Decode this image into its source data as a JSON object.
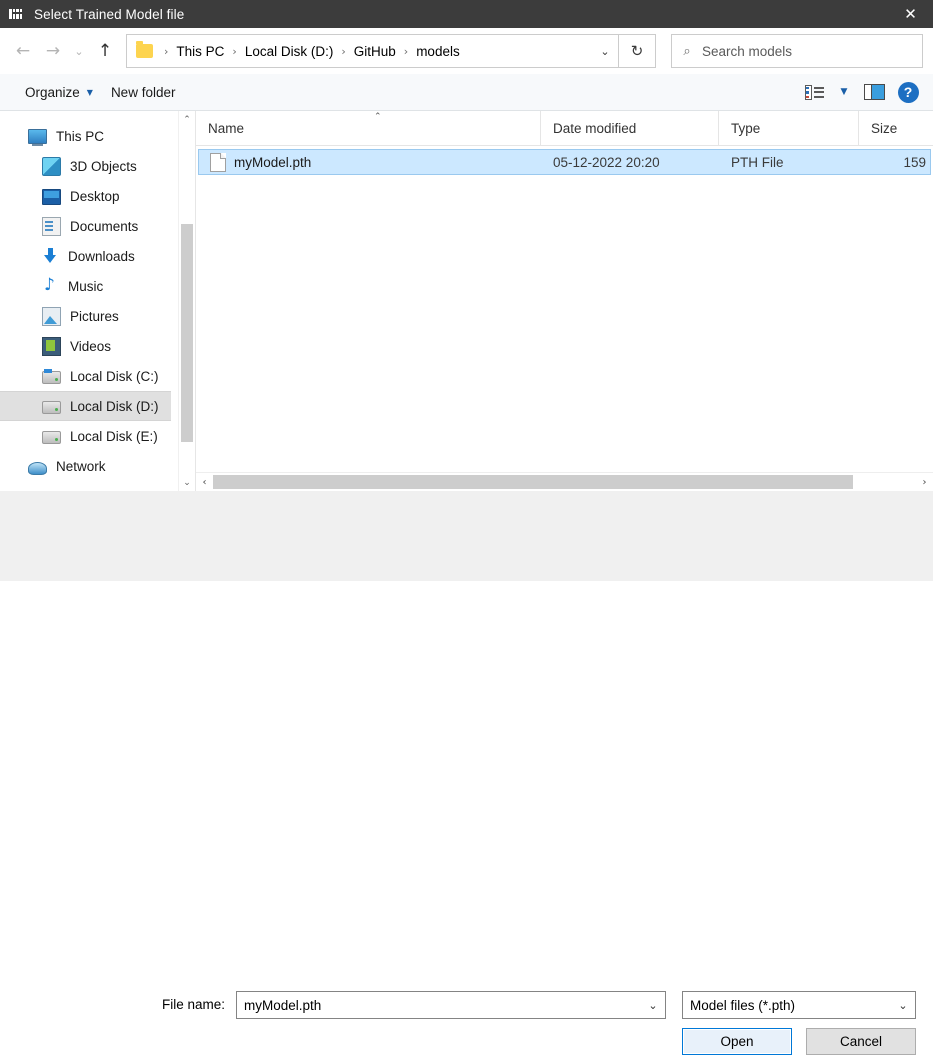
{
  "titlebar": {
    "title": "Select Trained Model file",
    "app_icon": "app-logo-icon",
    "close_label": "✕"
  },
  "navbar": {
    "back_glyph": "←",
    "forward_glyph": "→",
    "recent_glyph": "⌄",
    "up_glyph": "↑",
    "breadcrumbs": [
      "This PC",
      "Local Disk (D:)",
      "GitHub",
      "models"
    ],
    "separator": "›",
    "dropdown_glyph": "⌄",
    "refresh_glyph": "↻",
    "search": {
      "icon": "⌕",
      "placeholder": "Search models",
      "value": ""
    }
  },
  "toolbar": {
    "organize_label": "Organize",
    "organize_caret": "▼",
    "new_folder_label": "New folder",
    "view_caret": "▼",
    "help_label": "?"
  },
  "sidebar": {
    "items": [
      {
        "label": "This PC",
        "icon": "computer-icon",
        "indent": false,
        "selected": false
      },
      {
        "label": "3D Objects",
        "icon": "cube-icon",
        "indent": true,
        "selected": false
      },
      {
        "label": "Desktop",
        "icon": "desktop-icon",
        "indent": true,
        "selected": false
      },
      {
        "label": "Documents",
        "icon": "documents-icon",
        "indent": true,
        "selected": false
      },
      {
        "label": "Downloads",
        "icon": "downloads-icon",
        "indent": true,
        "selected": false
      },
      {
        "label": "Music",
        "icon": "music-icon",
        "indent": true,
        "selected": false
      },
      {
        "label": "Pictures",
        "icon": "pictures-icon",
        "indent": true,
        "selected": false
      },
      {
        "label": "Videos",
        "icon": "videos-icon",
        "indent": true,
        "selected": false
      },
      {
        "label": "Local Disk (C:)",
        "icon": "system-drive-icon",
        "indent": true,
        "selected": false
      },
      {
        "label": "Local Disk (D:)",
        "icon": "drive-icon",
        "indent": true,
        "selected": true
      },
      {
        "label": "Local Disk (E:)",
        "icon": "drive-icon",
        "indent": true,
        "selected": false
      },
      {
        "label": "Network",
        "icon": "network-icon",
        "indent": false,
        "selected": false
      }
    ],
    "scroll_up_glyph": "⌃",
    "scroll_down_glyph": "⌄"
  },
  "filelist": {
    "columns": [
      {
        "key": "name",
        "label": "Name"
      },
      {
        "key": "date",
        "label": "Date modified"
      },
      {
        "key": "type",
        "label": "Type"
      },
      {
        "key": "size",
        "label": "Size"
      }
    ],
    "sort_caret": "⌃",
    "rows": [
      {
        "name": "myModel.pth",
        "date": "05-12-2022 20:20",
        "type": "PTH File",
        "size": "159",
        "selected": true
      }
    ],
    "hscroll_left_glyph": "‹",
    "hscroll_right_glyph": "›"
  },
  "footer": {
    "filename_label": "File name:",
    "filename_value": "myModel.pth",
    "filetype_value": "Model files (*.pth)",
    "combo_arrow": "⌄",
    "open_label": "Open",
    "cancel_label": "Cancel"
  },
  "colors": {
    "titlebar_bg": "#3c3c3c",
    "selection_bg": "#cce8ff",
    "selection_border": "#9ac9ef",
    "sidebar_selected_bg": "#e0e0e0",
    "toolbar_bg": "#f7f9fb",
    "footer_bg": "#f0f0f0",
    "accent_blue": "#0078d7",
    "folder_yellow": "#fdd44f"
  }
}
